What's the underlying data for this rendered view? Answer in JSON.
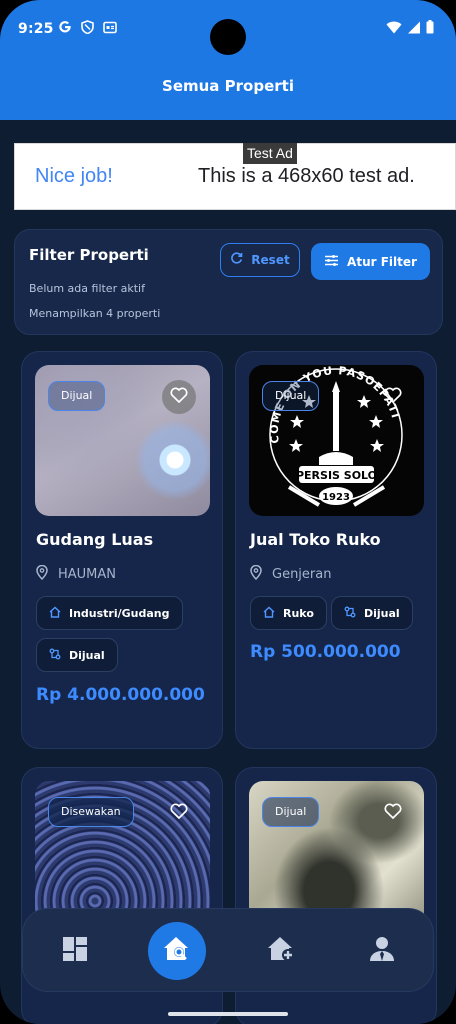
{
  "status_bar": {
    "time": "9:25",
    "icons": [
      "google-g-icon",
      "shield-icon",
      "calendar-card-icon"
    ],
    "right_icons": [
      "wifi-icon",
      "signal-icon",
      "battery-icon"
    ]
  },
  "app_bar": {
    "title": "Semua Properti"
  },
  "ad": {
    "badge": "Test Ad",
    "headline": "Nice job!",
    "description": "This is a 468x60 test ad."
  },
  "filter": {
    "title": "Filter Properti",
    "status": "Belum ada filter aktif",
    "count": "Menampilkan 4 properti",
    "reset_label": "Reset",
    "filter_label": "Atur Filter"
  },
  "properties": [
    {
      "badge": "Dijual",
      "name": "Gudang Luas",
      "location": "HAUMAN",
      "category": "Industri/Gudang",
      "type": "Dijual",
      "price": "Rp 4.000.000.000"
    },
    {
      "badge": "Dijual",
      "name": "Jual Toko Ruko",
      "location": "Genjeran",
      "category": "Ruko",
      "type": "Dijual",
      "price": "Rp 500.000.000",
      "image_text": {
        "top": "COME ON YOU PASOEPATI",
        "middle": "PERSIS SOLO",
        "year": "1923"
      }
    },
    {
      "badge": "Disewakan"
    },
    {
      "badge": "Dijual"
    }
  ],
  "nav": {
    "items": [
      {
        "icon": "dashboard-icon",
        "active": false
      },
      {
        "icon": "home-search-icon",
        "active": true
      },
      {
        "icon": "home-add-icon",
        "active": false
      },
      {
        "icon": "agent-profile-icon",
        "active": false
      }
    ]
  },
  "colors": {
    "primary": "#1e78e3",
    "background": "#0f1d33",
    "card": "#15264a",
    "price": "#3d8bff"
  }
}
